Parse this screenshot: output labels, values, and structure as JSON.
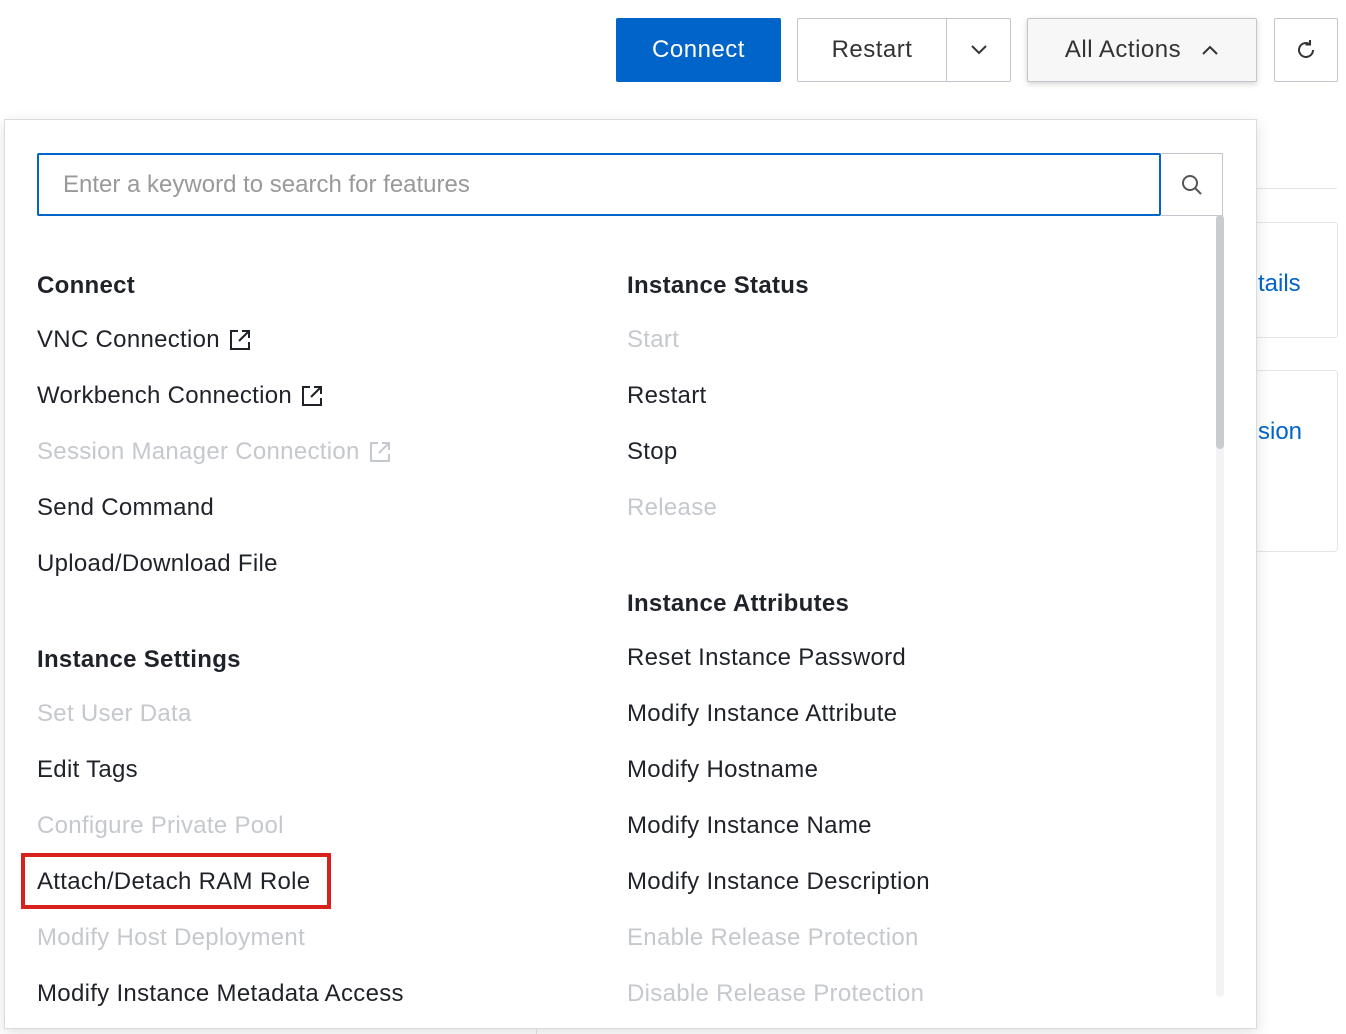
{
  "toolbar": {
    "connect_label": "Connect",
    "restart_label": "Restart",
    "all_actions_label": "All Actions"
  },
  "background": {
    "link_partial_1": "tails",
    "link_partial_2": "sion"
  },
  "search": {
    "placeholder": "Enter a keyword to search for features"
  },
  "groups": {
    "connect": {
      "title": "Connect",
      "items": [
        {
          "label": "VNC Connection",
          "disabled": false,
          "external": true
        },
        {
          "label": "Workbench Connection",
          "disabled": false,
          "external": true
        },
        {
          "label": "Session Manager Connection",
          "disabled": true,
          "external": true
        },
        {
          "label": "Send Command",
          "disabled": false,
          "external": false
        },
        {
          "label": "Upload/Download File",
          "disabled": false,
          "external": false
        }
      ]
    },
    "instance_settings": {
      "title": "Instance Settings",
      "items": [
        {
          "label": "Set User Data",
          "disabled": true
        },
        {
          "label": "Edit Tags",
          "disabled": false
        },
        {
          "label": "Configure Private Pool",
          "disabled": true
        },
        {
          "label": "Attach/Detach RAM Role",
          "disabled": false,
          "highlighted": true
        },
        {
          "label": "Modify Host Deployment",
          "disabled": true
        },
        {
          "label": "Modify Instance Metadata Access",
          "disabled": false
        }
      ]
    },
    "instance_status": {
      "title": "Instance Status",
      "items": [
        {
          "label": "Start",
          "disabled": true
        },
        {
          "label": "Restart",
          "disabled": false
        },
        {
          "label": "Stop",
          "disabled": false
        },
        {
          "label": "Release",
          "disabled": true
        }
      ]
    },
    "instance_attributes": {
      "title": "Instance Attributes",
      "items": [
        {
          "label": "Reset Instance Password",
          "disabled": false
        },
        {
          "label": "Modify Instance Attribute",
          "disabled": false
        },
        {
          "label": "Modify Hostname",
          "disabled": false
        },
        {
          "label": "Modify Instance Name",
          "disabled": false
        },
        {
          "label": "Modify Instance Description",
          "disabled": false
        },
        {
          "label": "Enable Release Protection",
          "disabled": true
        },
        {
          "label": "Disable Release Protection",
          "disabled": true
        }
      ]
    }
  },
  "colors": {
    "primary": "#0064c8",
    "disabled_text": "#c5c8cd",
    "highlight_border": "#d8211d"
  },
  "icons": {
    "caret_down": "chevron-down-icon",
    "caret_up": "chevron-up-icon",
    "refresh": "refresh-icon",
    "search": "search-icon",
    "external": "external-link-icon"
  }
}
